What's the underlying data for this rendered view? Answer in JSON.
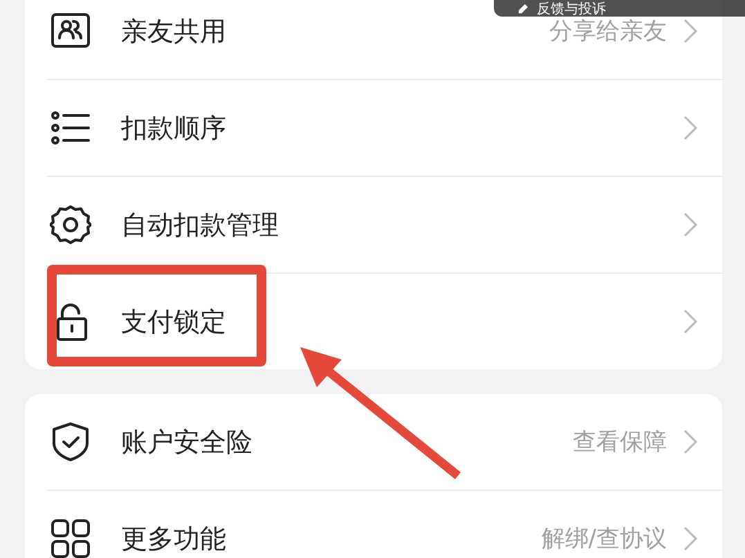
{
  "feedback_button": {
    "label": "反馈与投诉"
  },
  "groups": [
    {
      "rows": [
        {
          "kind": "family",
          "label": "亲友共用",
          "value": "分享给亲友",
          "highlighted": false
        },
        {
          "kind": "list",
          "label": "扣款顺序",
          "highlighted": false
        },
        {
          "kind": "gear",
          "label": "自动扣款管理",
          "highlighted": false
        },
        {
          "kind": "lock",
          "label": "支付锁定",
          "highlighted": true
        }
      ]
    },
    {
      "rows": [
        {
          "kind": "shield",
          "label": "账户安全险",
          "value": "查看保障",
          "highlighted": false
        },
        {
          "kind": "grid",
          "label": "更多功能",
          "value": "解绑/查协议",
          "highlighted": false
        }
      ]
    }
  ]
}
